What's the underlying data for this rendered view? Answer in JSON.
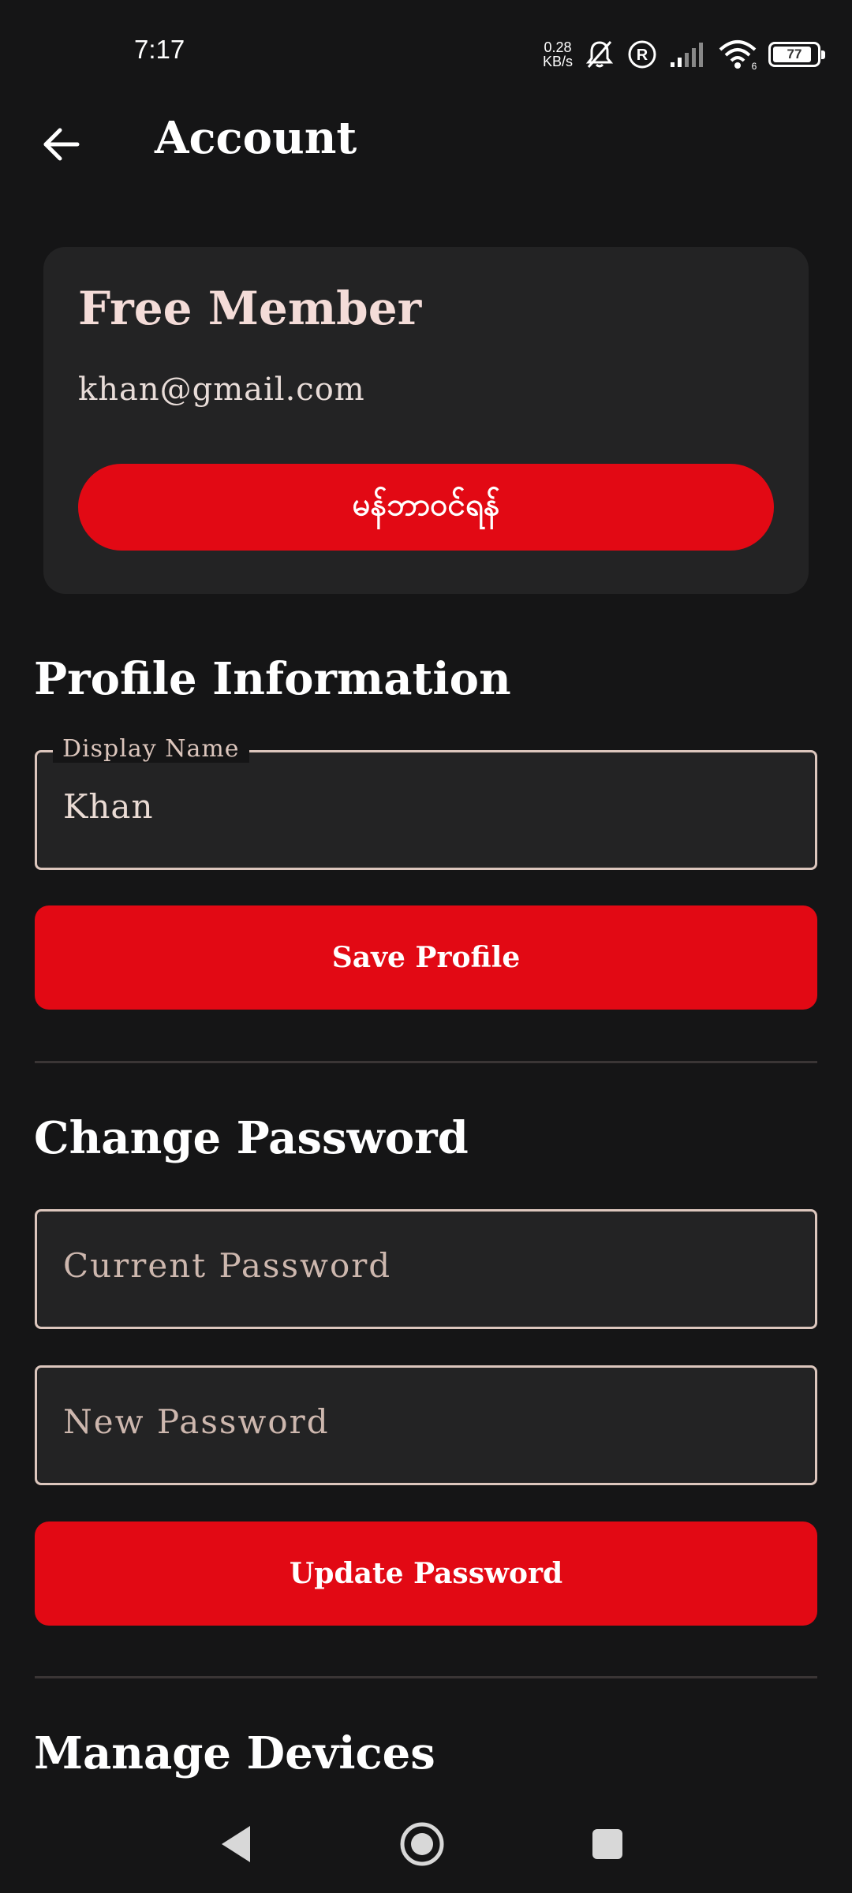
{
  "status_bar": {
    "time": "7:17",
    "net_speed_value": "0.28",
    "net_speed_unit": "KB/s",
    "wifi_badge": "6",
    "battery_level": "77"
  },
  "app_bar": {
    "title": "Account"
  },
  "member_card": {
    "title": "Free Member",
    "email": "khan@gmail.com",
    "subscribe_label": "မန်ဘာဝင်ရန်"
  },
  "profile": {
    "section_title": "Profile Information",
    "display_name_label": "Display Name",
    "display_name_value": "Khan",
    "save_label": "Save Profile"
  },
  "password": {
    "section_title": "Change Password",
    "current_placeholder": "Current Password",
    "new_placeholder": "New Password",
    "update_label": "Update Password"
  },
  "devices": {
    "section_title": "Manage Devices"
  },
  "colors": {
    "accent": "#e20914",
    "background": "#151516",
    "card": "#232324"
  }
}
